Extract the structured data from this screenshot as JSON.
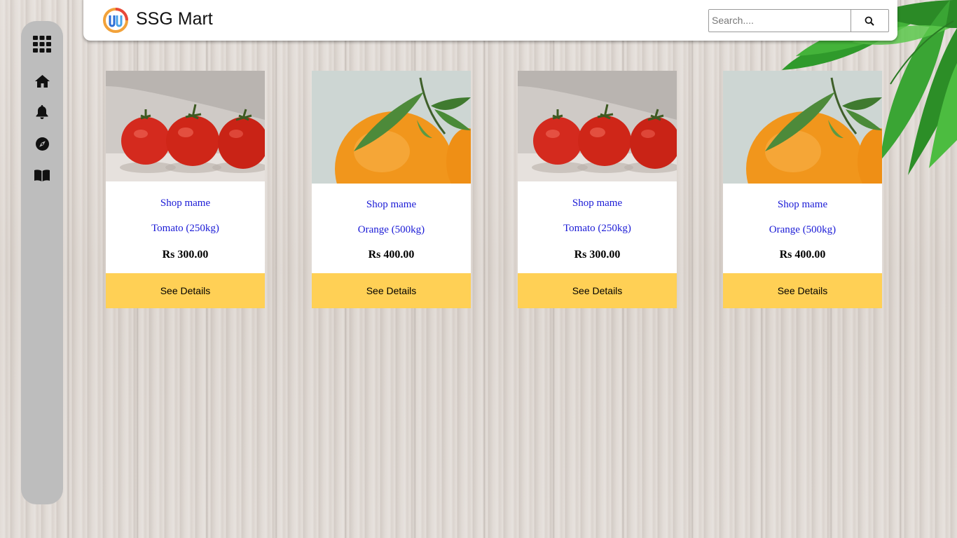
{
  "header": {
    "brand": "SSG Mart",
    "search_placeholder": "Search...."
  },
  "sidebar": {
    "items": [
      {
        "icon": "grid-icon"
      },
      {
        "icon": "home-icon"
      },
      {
        "icon": "bell-icon"
      },
      {
        "icon": "compass-icon"
      },
      {
        "icon": "book-icon"
      }
    ]
  },
  "products": [
    {
      "shop": "Shop mame",
      "name": "Tomato (250kg)",
      "price": "Rs 300.00",
      "button": "See Details",
      "image": "tomato"
    },
    {
      "shop": "Shop mame",
      "name": "Orange (500kg)",
      "price": "Rs 400.00",
      "button": "See Details",
      "image": "orange"
    },
    {
      "shop": "Shop mame",
      "name": "Tomato (250kg)",
      "price": "Rs 300.00",
      "button": "See Details",
      "image": "tomato"
    },
    {
      "shop": "Shop mame",
      "name": "Orange (500kg)",
      "price": "Rs 400.00",
      "button": "See Details",
      "image": "orange"
    }
  ],
  "colors": {
    "button": "#ffd055",
    "link_text": "#1a1ad6",
    "sidebar": "#bdbdbd"
  }
}
